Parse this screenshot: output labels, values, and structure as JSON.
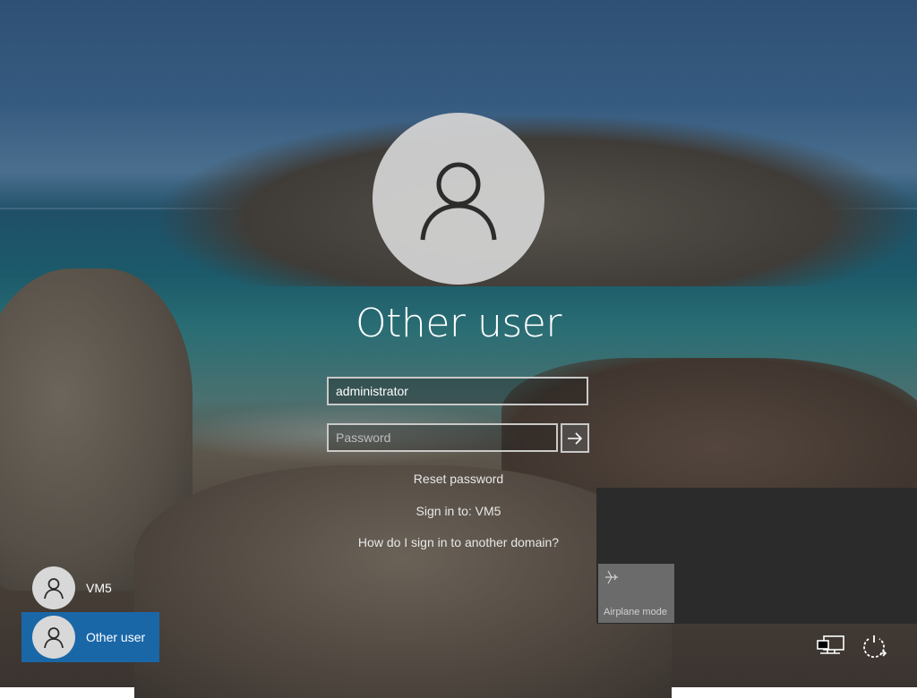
{
  "user": {
    "display_name": "Other user"
  },
  "form": {
    "username_value": "administrator",
    "password_placeholder": "Password",
    "submit_icon": "arrow-right-icon"
  },
  "links": {
    "reset_password": "Reset password",
    "sign_in_to": "Sign in to: VM5",
    "other_domain": "How do I sign in to another domain?"
  },
  "user_list": [
    {
      "name": "VM5",
      "selected": false
    },
    {
      "name": "Other user",
      "selected": true
    }
  ],
  "network_flyout": {
    "quick_action": {
      "label": "Airplane mode",
      "icon": "airplane-icon"
    }
  },
  "system_icons": [
    "network-icon",
    "power-icon"
  ],
  "colors": {
    "selected_tile": "#1a67a8",
    "flyout_bg": "#2b2b2b",
    "tile_bg": "#6b6b6b"
  }
}
